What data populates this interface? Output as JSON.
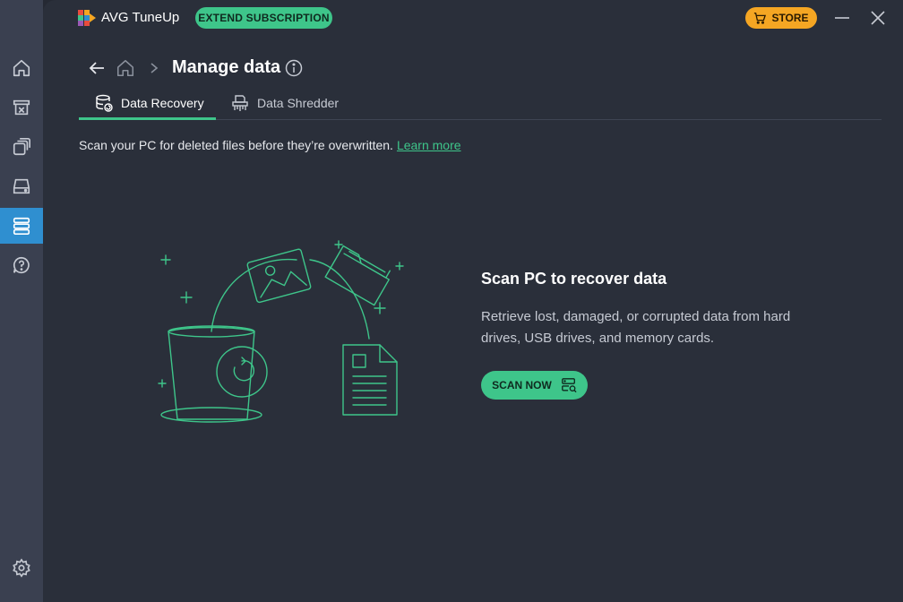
{
  "app": {
    "name": "AVG TuneUp",
    "extend_label": "EXTEND SUBSCRIPTION",
    "store_label": "STORE"
  },
  "header": {
    "title": "Manage data"
  },
  "tabs": [
    {
      "label": "Data Recovery",
      "active": true
    },
    {
      "label": "Data Shredder",
      "active": false
    }
  ],
  "intro": {
    "text": "Scan your PC for deleted files before they’re overwritten.",
    "link": "Learn more"
  },
  "cta": {
    "title": "Scan PC to recover data",
    "description": "Retrieve lost, damaged, or corrupted data from hard drives, USB drives, and memory cards.",
    "button": "SCAN NOW"
  },
  "sidebar": {
    "items": [
      {
        "icon": "home-icon"
      },
      {
        "icon": "archive-icon"
      },
      {
        "icon": "layers-icon"
      },
      {
        "icon": "drive-icon"
      },
      {
        "icon": "data-list-icon",
        "active": true
      },
      {
        "icon": "help-icon"
      },
      {
        "icon": "gear-icon"
      }
    ]
  },
  "colors": {
    "accent": "#3ec58a",
    "store": "#f5a623",
    "active_rail": "#2f8fd0"
  }
}
